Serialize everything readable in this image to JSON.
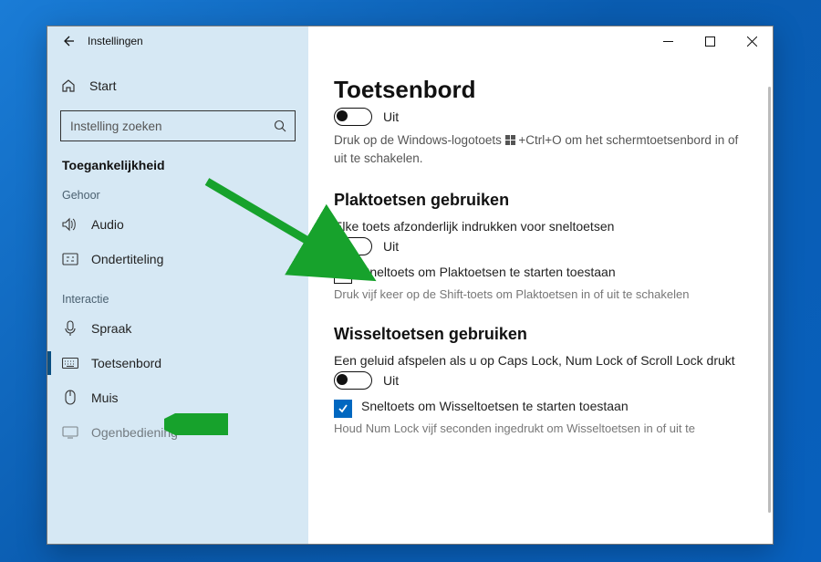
{
  "window": {
    "app_title": "Instellingen"
  },
  "sidebar": {
    "home_label": "Start",
    "search_placeholder": "Instelling zoeken",
    "page_name": "Toegankelijkheid",
    "groups": {
      "hearing": {
        "label": "Gehoor",
        "audio": "Audio",
        "subtitles": "Ondertiteling"
      },
      "interaction": {
        "label": "Interactie",
        "speech": "Spraak",
        "keyboard": "Toetsenbord",
        "mouse": "Muis",
        "eye": "Ogenbediening"
      }
    }
  },
  "content": {
    "title": "Toetsenbord",
    "osk": {
      "toggle_state": "Uit",
      "hint_pre": "Druk op de Windows-logotoets ",
      "hint_post": " +Ctrl+O om het schermtoetsenbord in of uit te schakelen."
    },
    "sticky": {
      "heading": "Plaktoetsen gebruiken",
      "subheading": "Elke toets afzonderlijk indrukken voor sneltoetsen",
      "toggle_state": "Uit",
      "checkbox_label": "Sneltoets om Plaktoetsen te starten toestaan",
      "hint": "Druk vijf keer op de Shift-toets om Plaktoetsen in of uit te schakelen"
    },
    "toggle_keys": {
      "heading": "Wisseltoetsen gebruiken",
      "subheading": "Een geluid afspelen als u op Caps Lock, Num Lock of Scroll Lock drukt",
      "toggle_state": "Uit",
      "checkbox_label": "Sneltoets om Wisseltoetsen te starten toestaan",
      "hint": "Houd Num Lock vijf seconden ingedrukt om Wisseltoetsen in of uit te"
    }
  }
}
